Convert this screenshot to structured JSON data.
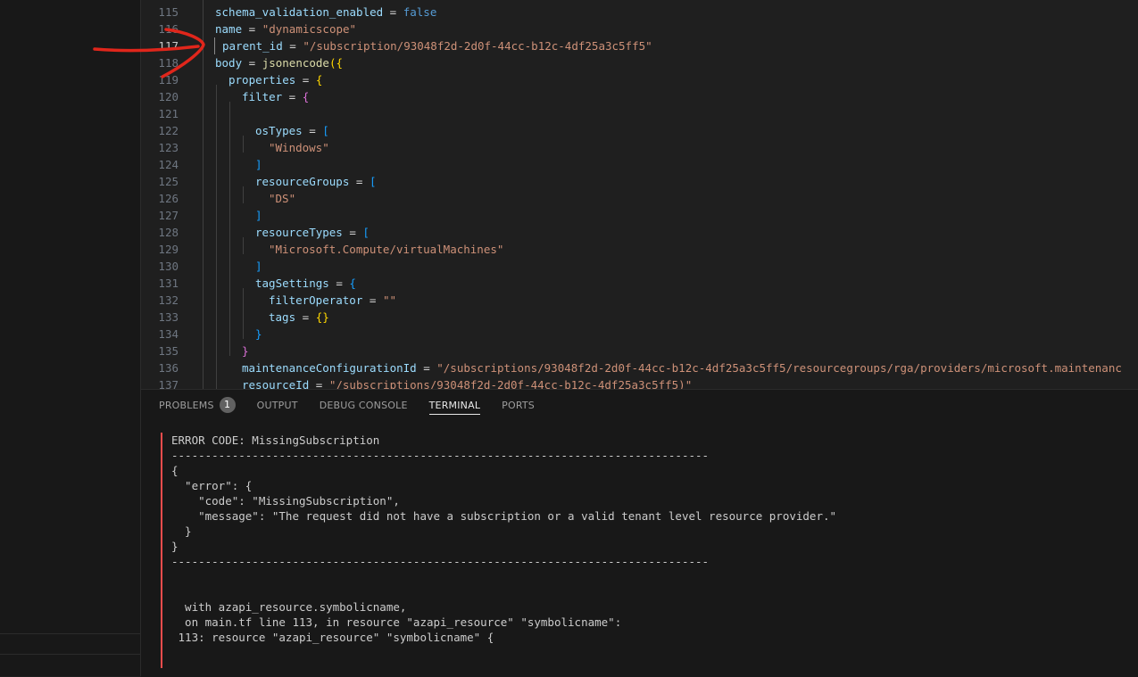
{
  "editor": {
    "line_numbers": [
      "115",
      "116",
      "117",
      "118",
      "119",
      "120",
      "121",
      "122",
      "123",
      "124",
      "125",
      "126",
      "127",
      "128",
      "129",
      "130",
      "131",
      "132",
      "133",
      "134",
      "135",
      "136",
      "137"
    ],
    "active_line": "117",
    "code": {
      "l115": {
        "key": "schema_validation_enabled",
        "eq": " = ",
        "val": "false"
      },
      "l116": {
        "key": "name",
        "eq": " = ",
        "val": "\"dynamicscope\""
      },
      "l117": {
        "key": "parent_id",
        "eq": " = ",
        "val": "\"/subscription/93048f2d-2d0f-44cc-b12c-4df25a3c5ff5\""
      },
      "l118": {
        "key": "body",
        "eq": " = ",
        "func": "jsonencode",
        "open": "({"
      },
      "l119": {
        "key": "properties",
        "eq": " = ",
        "open": "{"
      },
      "l120": {
        "key": "filter",
        "eq": " = ",
        "open": "{"
      },
      "l122": {
        "key": "osTypes",
        "eq": " = ",
        "open": "["
      },
      "l123": {
        "val": "\"Windows\""
      },
      "l124": {
        "close": "]"
      },
      "l125": {
        "key": "resourceGroups",
        "eq": " = ",
        "open": "["
      },
      "l126": {
        "val": "\"DS\""
      },
      "l127": {
        "close": "]"
      },
      "l128": {
        "key": "resourceTypes",
        "eq": " = ",
        "open": "["
      },
      "l129": {
        "val": "\"Microsoft.Compute/virtualMachines\""
      },
      "l130": {
        "close": "]"
      },
      "l131": {
        "key": "tagSettings",
        "eq": " = ",
        "open": "{"
      },
      "l132": {
        "key": "filterOperator",
        "eq": " = ",
        "val": "\"\""
      },
      "l133": {
        "key": "tags",
        "eq": " = ",
        "val": "{}"
      },
      "l134": {
        "close": "}"
      },
      "l135": {
        "close": "}"
      },
      "l136": {
        "key": "maintenanceConfigurationId",
        "eq": " = ",
        "val": "\"/subscriptions/93048f2d-2d0f-44cc-b12c-4df25a3c5ff5/resourcegroups/rga/providers/microsoft.maintenanc"
      },
      "l137": {
        "key": "resourceId",
        "eq": " = ",
        "val": "\"/subscriptions/93048f2d-2d0f-44cc-b12c-4df25a3c5ff5)\""
      }
    }
  },
  "panel": {
    "tabs": {
      "problems": "PROBLEMS",
      "problems_count": "1",
      "output": "OUTPUT",
      "debug_console": "DEBUG CONSOLE",
      "terminal": "TERMINAL",
      "ports": "PORTS"
    },
    "active_tab": "TERMINAL",
    "terminal_lines": [
      "ERROR CODE: MissingSubscription",
      "--------------------------------------------------------------------------------",
      "{",
      "  \"error\": {",
      "    \"code\": \"MissingSubscription\",",
      "    \"message\": \"The request did not have a subscription or a valid tenant level resource provider.\"",
      "  }",
      "}",
      "--------------------------------------------------------------------------------",
      "",
      "",
      "  with azapi_resource.symbolicname,",
      "  on main.tf line 113, in resource \"azapi_resource\" \"symbolicname\":",
      " 113: resource \"azapi_resource\" \"symbolicname\" {"
    ]
  },
  "colors": {
    "annotation_arrow": "#e0261b",
    "error_bar": "#f14c4c",
    "string": "#ce9178",
    "keyword": "#569cd6",
    "property": "#9cdcfe"
  }
}
